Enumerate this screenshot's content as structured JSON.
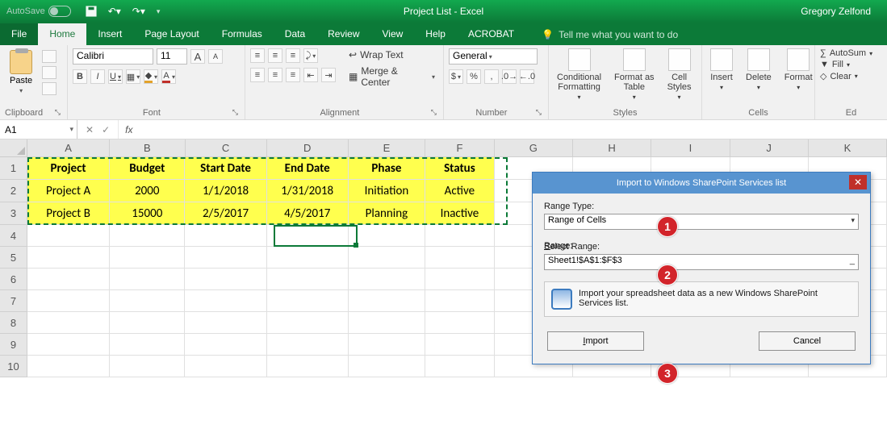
{
  "titlebar": {
    "autosave": "AutoSave",
    "title": "Project List  -  Excel",
    "user": "Gregory Zelfond"
  },
  "tabs": {
    "file": "File",
    "home": "Home",
    "insert": "Insert",
    "page_layout": "Page Layout",
    "formulas": "Formulas",
    "data": "Data",
    "review": "Review",
    "view": "View",
    "help": "Help",
    "acrobat": "ACROBAT",
    "tell_me": "Tell me what you want to do"
  },
  "ribbon": {
    "clipboard": {
      "label": "Clipboard",
      "paste": "Paste"
    },
    "font": {
      "label": "Font",
      "name": "Calibri",
      "size": "11",
      "increase": "A",
      "decrease": "A"
    },
    "alignment": {
      "label": "Alignment",
      "wrap": "Wrap Text",
      "merge": "Merge & Center"
    },
    "number": {
      "label": "Number",
      "format": "General"
    },
    "styles": {
      "label": "Styles",
      "cond": "Conditional\nFormatting",
      "table": "Format as\nTable",
      "cell": "Cell\nStyles"
    },
    "cells": {
      "label": "Cells",
      "insert": "Insert",
      "delete": "Delete",
      "format": "Format"
    },
    "editing": {
      "label": "Ed",
      "autosum": "AutoSum",
      "fill": "Fill",
      "clear": "Clear"
    }
  },
  "namebox": "A1",
  "columns": [
    "A",
    "B",
    "C",
    "D",
    "E",
    "F",
    "G",
    "H",
    "I",
    "J",
    "K"
  ],
  "rows": [
    "1",
    "2",
    "3",
    "4",
    "5",
    "6",
    "7",
    "8",
    "9",
    "10"
  ],
  "sheet": {
    "headers": [
      "Project",
      "Budget",
      "Start Date",
      "End Date",
      "Phase",
      "Status"
    ],
    "data": [
      [
        "Project A",
        "2000",
        "1/1/2018",
        "1/31/2018",
        "Initiation",
        "Active"
      ],
      [
        "Project B",
        "15000",
        "2/5/2017",
        "4/5/2017",
        "Planning",
        "Inactive"
      ]
    ]
  },
  "dialog": {
    "title": "Import to Windows SharePoint Services list",
    "range_type_label": "Range Type:",
    "range_type_value": "Range of Cells",
    "select_range_label": "Select Range:",
    "select_range_value": "Sheet1!$A$1:$F$3",
    "info": "Import your spreadsheet data as a new Windows SharePoint Services list.",
    "import": "Import",
    "cancel": "Cancel"
  },
  "callouts": {
    "one": "1",
    "two": "2",
    "three": "3"
  }
}
